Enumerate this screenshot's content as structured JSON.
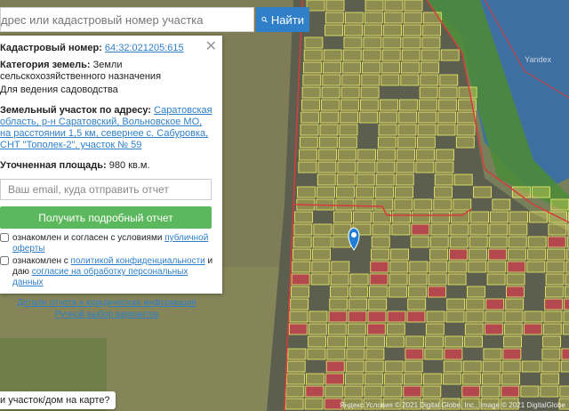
{
  "search": {
    "placeholder": "дрес или кадастровый номер участка",
    "button_label": "Найти"
  },
  "panel": {
    "cadastral_label": "Кадастровый номер:",
    "cadastral_value": "64:32:021205:615",
    "category_label": "Категория земель:",
    "category_value": "Земли сельскохозяйственного назначения",
    "usage_value": "Для ведения садоводства",
    "address_label": "Земельный участок по адресу:",
    "address_value": "Саратовская область, р-н Саратовский, Вольновское МО, на расстоянии 1,5 км, севернее с. Сабуровка, СНТ \"Тополек-2\", участок № 59",
    "area_label": "Уточненная площадь:",
    "area_value": "980 кв.м.",
    "email_placeholder": "Ваш email, куда отправить отчет",
    "get_report_label": "Получить подробный отчет",
    "consent1_prefix": "ознакомлен и согласен с условиями ",
    "consent1_link": "публичной оферты",
    "consent2_prefix": "ознакомлен с ",
    "consent2_link": "политикой конфиденциальности",
    "consent2_mid": " и даю",
    "consent2_link2": "согласие на обработку персональных данных",
    "details_link": "Детали отчета и юридическая информация",
    "manual_link": "Ручной выбор вариантов"
  },
  "question_label": "и участок/дом на карте?",
  "attribution": "Яндекс Условия  © 2021 Digital Globe, Inc., Image © 2021 DigitalGlobe",
  "map_logo": "Yandex",
  "colors": {
    "accent": "#2f7fc9",
    "green": "#5cb85c",
    "parcel": "#e8e65a",
    "boundary": "#d83b3b"
  }
}
